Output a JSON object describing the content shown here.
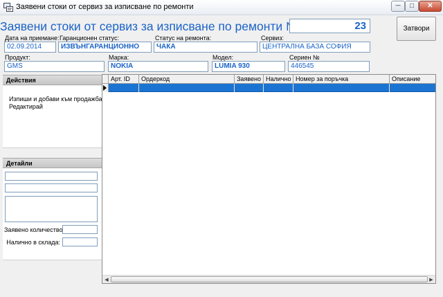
{
  "window": {
    "title": "Заявени стоки от сервиз за изписване по ремонти",
    "min_glyph": "─",
    "max_glyph": "□",
    "close_glyph": "✕"
  },
  "header": {
    "heading": "Заявени стоки от сервиз за изписване по ремонти №",
    "repair_number": "23",
    "close_button": "Затвори"
  },
  "fields": {
    "received_date": {
      "label": "Дата на приемане:",
      "value": "02.09.2014"
    },
    "warranty_status": {
      "label": "Гаранционен статус:",
      "value": "ИЗВЪНГАРАНЦИОННО"
    },
    "repair_status": {
      "label": "Статус на ремонта:",
      "value": "ЧАКА"
    },
    "service": {
      "label": "Сервиз:",
      "value": "ЦЕНТРАЛНА БАЗА СОФИЯ"
    },
    "product": {
      "label": "Продукт:",
      "value": "GMS"
    },
    "brand": {
      "label": "Марка:",
      "value": "NOKIA"
    },
    "model": {
      "label": "Модел:",
      "value": "LUMIA 930"
    },
    "serial": {
      "label": "Сериен №",
      "value": "446545"
    }
  },
  "actions": {
    "title": "Действия",
    "items": [
      "Изпиши и добави към продажбата",
      "Редактирай"
    ]
  },
  "details": {
    "title": "Детайли",
    "requested_qty_label": "Заявено количество:",
    "in_stock_label": "Налично в склада:"
  },
  "grid": {
    "columns": [
      "Арт. ID",
      "Ордеркод",
      "Заявено",
      "Налично",
      "Номер за поръчка",
      "Описание"
    ]
  },
  "colors": {
    "accent": "#1b63c7",
    "selected_row": "#1c74d2"
  }
}
